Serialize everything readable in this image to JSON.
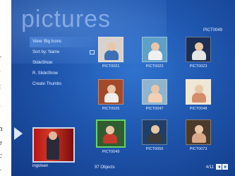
{
  "margin_text": [
    "r",
    "i",
    "t",
    "i",
    "n",
    "e",
    "c",
    "r"
  ],
  "title": "pictures",
  "selected_name": "PICT0049",
  "menu": [
    {
      "label": "View: Big Icons",
      "highlighted": true
    },
    {
      "label": "Sort by: Name",
      "highlighted": false,
      "has_check": true
    },
    {
      "label": "SlideShow",
      "highlighted": false
    },
    {
      "label": "R. SlideShow",
      "highlighted": false
    },
    {
      "label": "Create Thumbs",
      "highlighted": false
    }
  ],
  "thumbnails": [
    {
      "label": "PICT0021",
      "selected": false,
      "colors": {
        "bg": "#d9d2cc",
        "body": "#3c6fb3"
      }
    },
    {
      "label": "PICT0022",
      "selected": false,
      "colors": {
        "bg": "#5fa0c8",
        "body": "#f0f0f0"
      }
    },
    {
      "label": "PICT0023",
      "selected": false,
      "colors": {
        "bg": "#1b2e55",
        "body": "#e5e5e5"
      }
    },
    {
      "label": "PICT0025",
      "selected": false,
      "colors": {
        "bg": "#a34a2b",
        "body": "#f1efe9"
      }
    },
    {
      "label": "PICT0047",
      "selected": false,
      "colors": {
        "bg": "#8fb4cf",
        "body": "#f3d0b3"
      }
    },
    {
      "label": "PICT0048",
      "selected": false,
      "colors": {
        "bg": "#efe6d5",
        "body": "#d58c6a"
      }
    },
    {
      "label": "PICT0049",
      "selected": true,
      "colors": {
        "bg": "#2f5d2f",
        "body": "#c33b2e"
      }
    },
    {
      "label": "PICT0056",
      "selected": false,
      "colors": {
        "bg": "#1f3f6b",
        "body": "#3a3a3a"
      }
    },
    {
      "label": "PICT0073",
      "selected": false,
      "colors": {
        "bg": "#4b3a2c",
        "body": "#d9a887"
      }
    }
  ],
  "preview_label": "ingolsen",
  "object_count": "97 Objects",
  "page_indicator": "4/11",
  "colors": {
    "screen_bg": "#1f56ae",
    "selected_border": "#67d36a",
    "text": "#e8f0ff"
  }
}
